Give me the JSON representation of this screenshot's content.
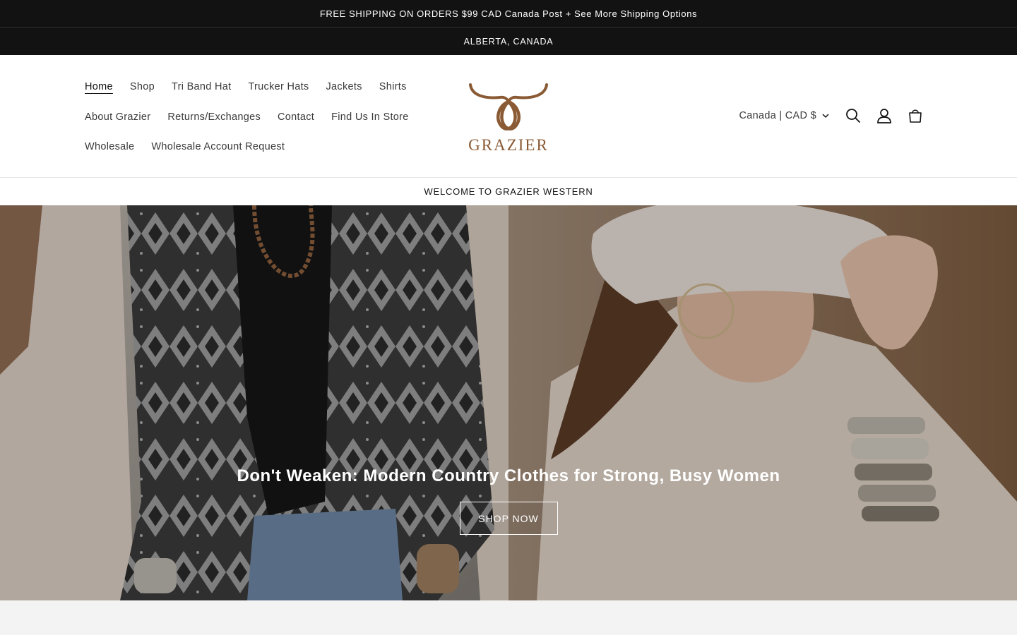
{
  "announcement": {
    "shipping_text": "FREE SHIPPING ON ORDERS $99 CAD Canada Post + See More Shipping Options",
    "location_text": "ALBERTA, CANADA"
  },
  "header": {
    "nav": {
      "row1": [
        {
          "label": "Home",
          "active": true
        },
        {
          "label": "Shop"
        },
        {
          "label": "Tri Band Hat"
        },
        {
          "label": "Trucker Hats"
        },
        {
          "label": "Jackets"
        },
        {
          "label": "Shirts"
        }
      ],
      "row2": [
        {
          "label": "About Grazier"
        },
        {
          "label": "Returns/Exchanges"
        },
        {
          "label": "Contact"
        },
        {
          "label": "Find Us In Store"
        }
      ],
      "row3": [
        {
          "label": "Wholesale"
        },
        {
          "label": "Wholesale Account Request"
        }
      ]
    },
    "logo_text": "GRAZIER",
    "currency_label": "Canada | CAD $",
    "icons": [
      "search-icon",
      "account-icon",
      "cart-icon",
      "chevron-down-icon"
    ]
  },
  "welcome_text": "WELCOME TO GRAZIER WESTERN",
  "hero": {
    "title": "Don't Weaken: Modern Country Clothes for Strong, Busy Women",
    "button_label": "SHOP NOW"
  },
  "colors": {
    "announcement_bg": "#121212",
    "brand_brown": "#8a5a34",
    "text": "#121212"
  }
}
